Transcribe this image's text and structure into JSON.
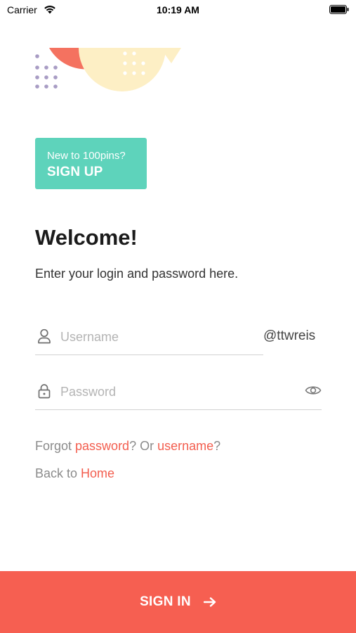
{
  "status_bar": {
    "carrier": "Carrier",
    "time": "10:19 AM"
  },
  "signup": {
    "prompt": "New to 100pins?",
    "label": "SIGN UP"
  },
  "welcome": {
    "title": "Welcome!",
    "subtitle": "Enter your login and password here."
  },
  "username": {
    "placeholder": "Username",
    "suffix": "@ttwreis",
    "icon": "user-icon"
  },
  "password": {
    "placeholder": "Password",
    "icon": "lock-icon",
    "toggle_icon": "eye-icon"
  },
  "links": {
    "forgot_prefix": "Forgot ",
    "password_link": "password",
    "forgot_middle": "? Or ",
    "username_link": "username",
    "forgot_suffix": "?",
    "back_prefix": "Back to ",
    "home_link": "Home"
  },
  "signin": {
    "label": "SIGN IN",
    "icon": "arrow-right-icon"
  },
  "colors": {
    "accent": "#f65f51",
    "signup_bg": "#5ed3bb",
    "deco_salmon": "#f47260",
    "deco_cream": "#fdefc5",
    "deco_dots": "#a89cc4"
  }
}
